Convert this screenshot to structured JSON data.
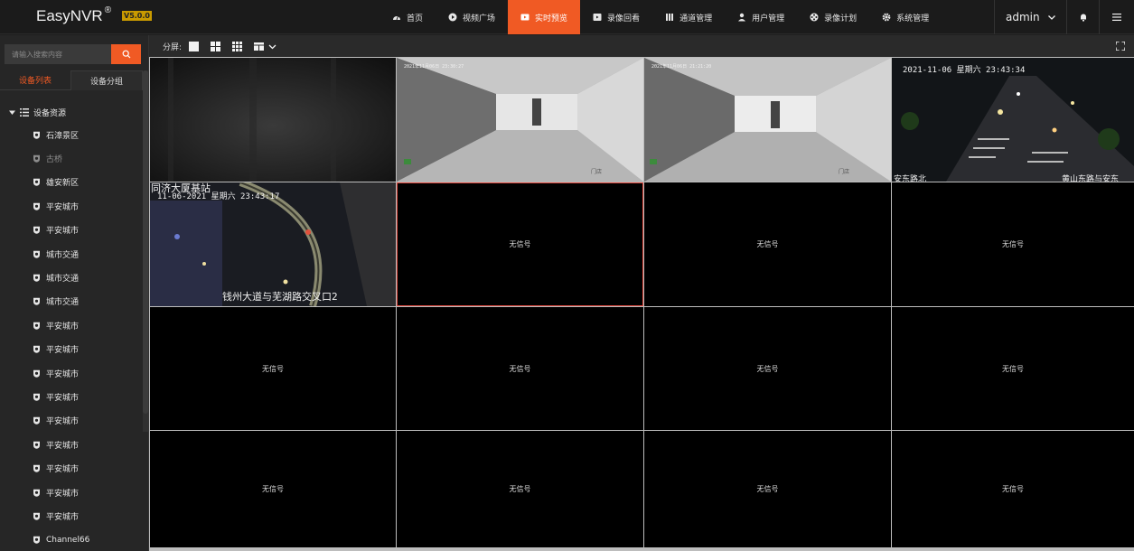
{
  "app": {
    "brand": "EasyNVR",
    "brand_mark": "®",
    "version": "V5.0.0"
  },
  "nav": {
    "items": [
      {
        "label": "首页",
        "icon": "dashboard-icon"
      },
      {
        "label": "视频广场",
        "icon": "play-circle-icon"
      },
      {
        "label": "实时预览",
        "icon": "live-video-icon"
      },
      {
        "label": "录像回看",
        "icon": "playback-icon"
      },
      {
        "label": "通道管理",
        "icon": "channel-icon"
      },
      {
        "label": "用户管理",
        "icon": "user-icon"
      },
      {
        "label": "录像计划",
        "icon": "film-reel-icon"
      },
      {
        "label": "系统管理",
        "icon": "gear-icon"
      }
    ],
    "active_index": 2,
    "user": "admin"
  },
  "sidebar": {
    "search_placeholder": "请输入搜索内容",
    "tabs": [
      "设备列表",
      "设备分组"
    ],
    "root_label": "设备资源",
    "items": [
      {
        "label": "石漳景区",
        "online": true
      },
      {
        "label": "古桥",
        "online": false
      },
      {
        "label": "雄安新区",
        "online": true
      },
      {
        "label": "平安城市",
        "online": true
      },
      {
        "label": "平安城市",
        "online": true
      },
      {
        "label": "城市交通",
        "online": true
      },
      {
        "label": "城市交通",
        "online": true
      },
      {
        "label": "城市交通",
        "online": true
      },
      {
        "label": "平安城市",
        "online": true
      },
      {
        "label": "平安城市",
        "online": true
      },
      {
        "label": "平安城市",
        "online": true
      },
      {
        "label": "平安城市",
        "online": true
      },
      {
        "label": "平安城市",
        "online": true
      },
      {
        "label": "平安城市",
        "online": true
      },
      {
        "label": "平安城市",
        "online": true
      },
      {
        "label": "平安城市",
        "online": true
      },
      {
        "label": "平安城市",
        "online": true
      },
      {
        "label": "Channel66",
        "online": true
      }
    ]
  },
  "toolbar": {
    "split_label": "分屏:"
  },
  "grid": {
    "no_signal": "无信号",
    "feeds": [
      {
        "type": "dark"
      },
      {
        "type": "corridor",
        "timestamp": "2021年11月06日 23:30:27",
        "watermark": "门店"
      },
      {
        "type": "corridor",
        "timestamp": "2021年11月06日 21:21:20",
        "watermark": "门店"
      },
      {
        "type": "street",
        "timestamp": "2021-11-06 星期六 23:43:34",
        "caption_left": "安东路北",
        "caption_right": "黄山东路与安东"
      },
      {
        "type": "aerial",
        "title": "同济大厦基站",
        "timestamp": "11-06-2021 星期六 23:43:17",
        "caption": "钱州大道与芜湖路交叉口2"
      }
    ]
  },
  "colors": {
    "accent": "#f05a24",
    "selected_border": "#e0483e",
    "version_badge": "#c99a00"
  }
}
